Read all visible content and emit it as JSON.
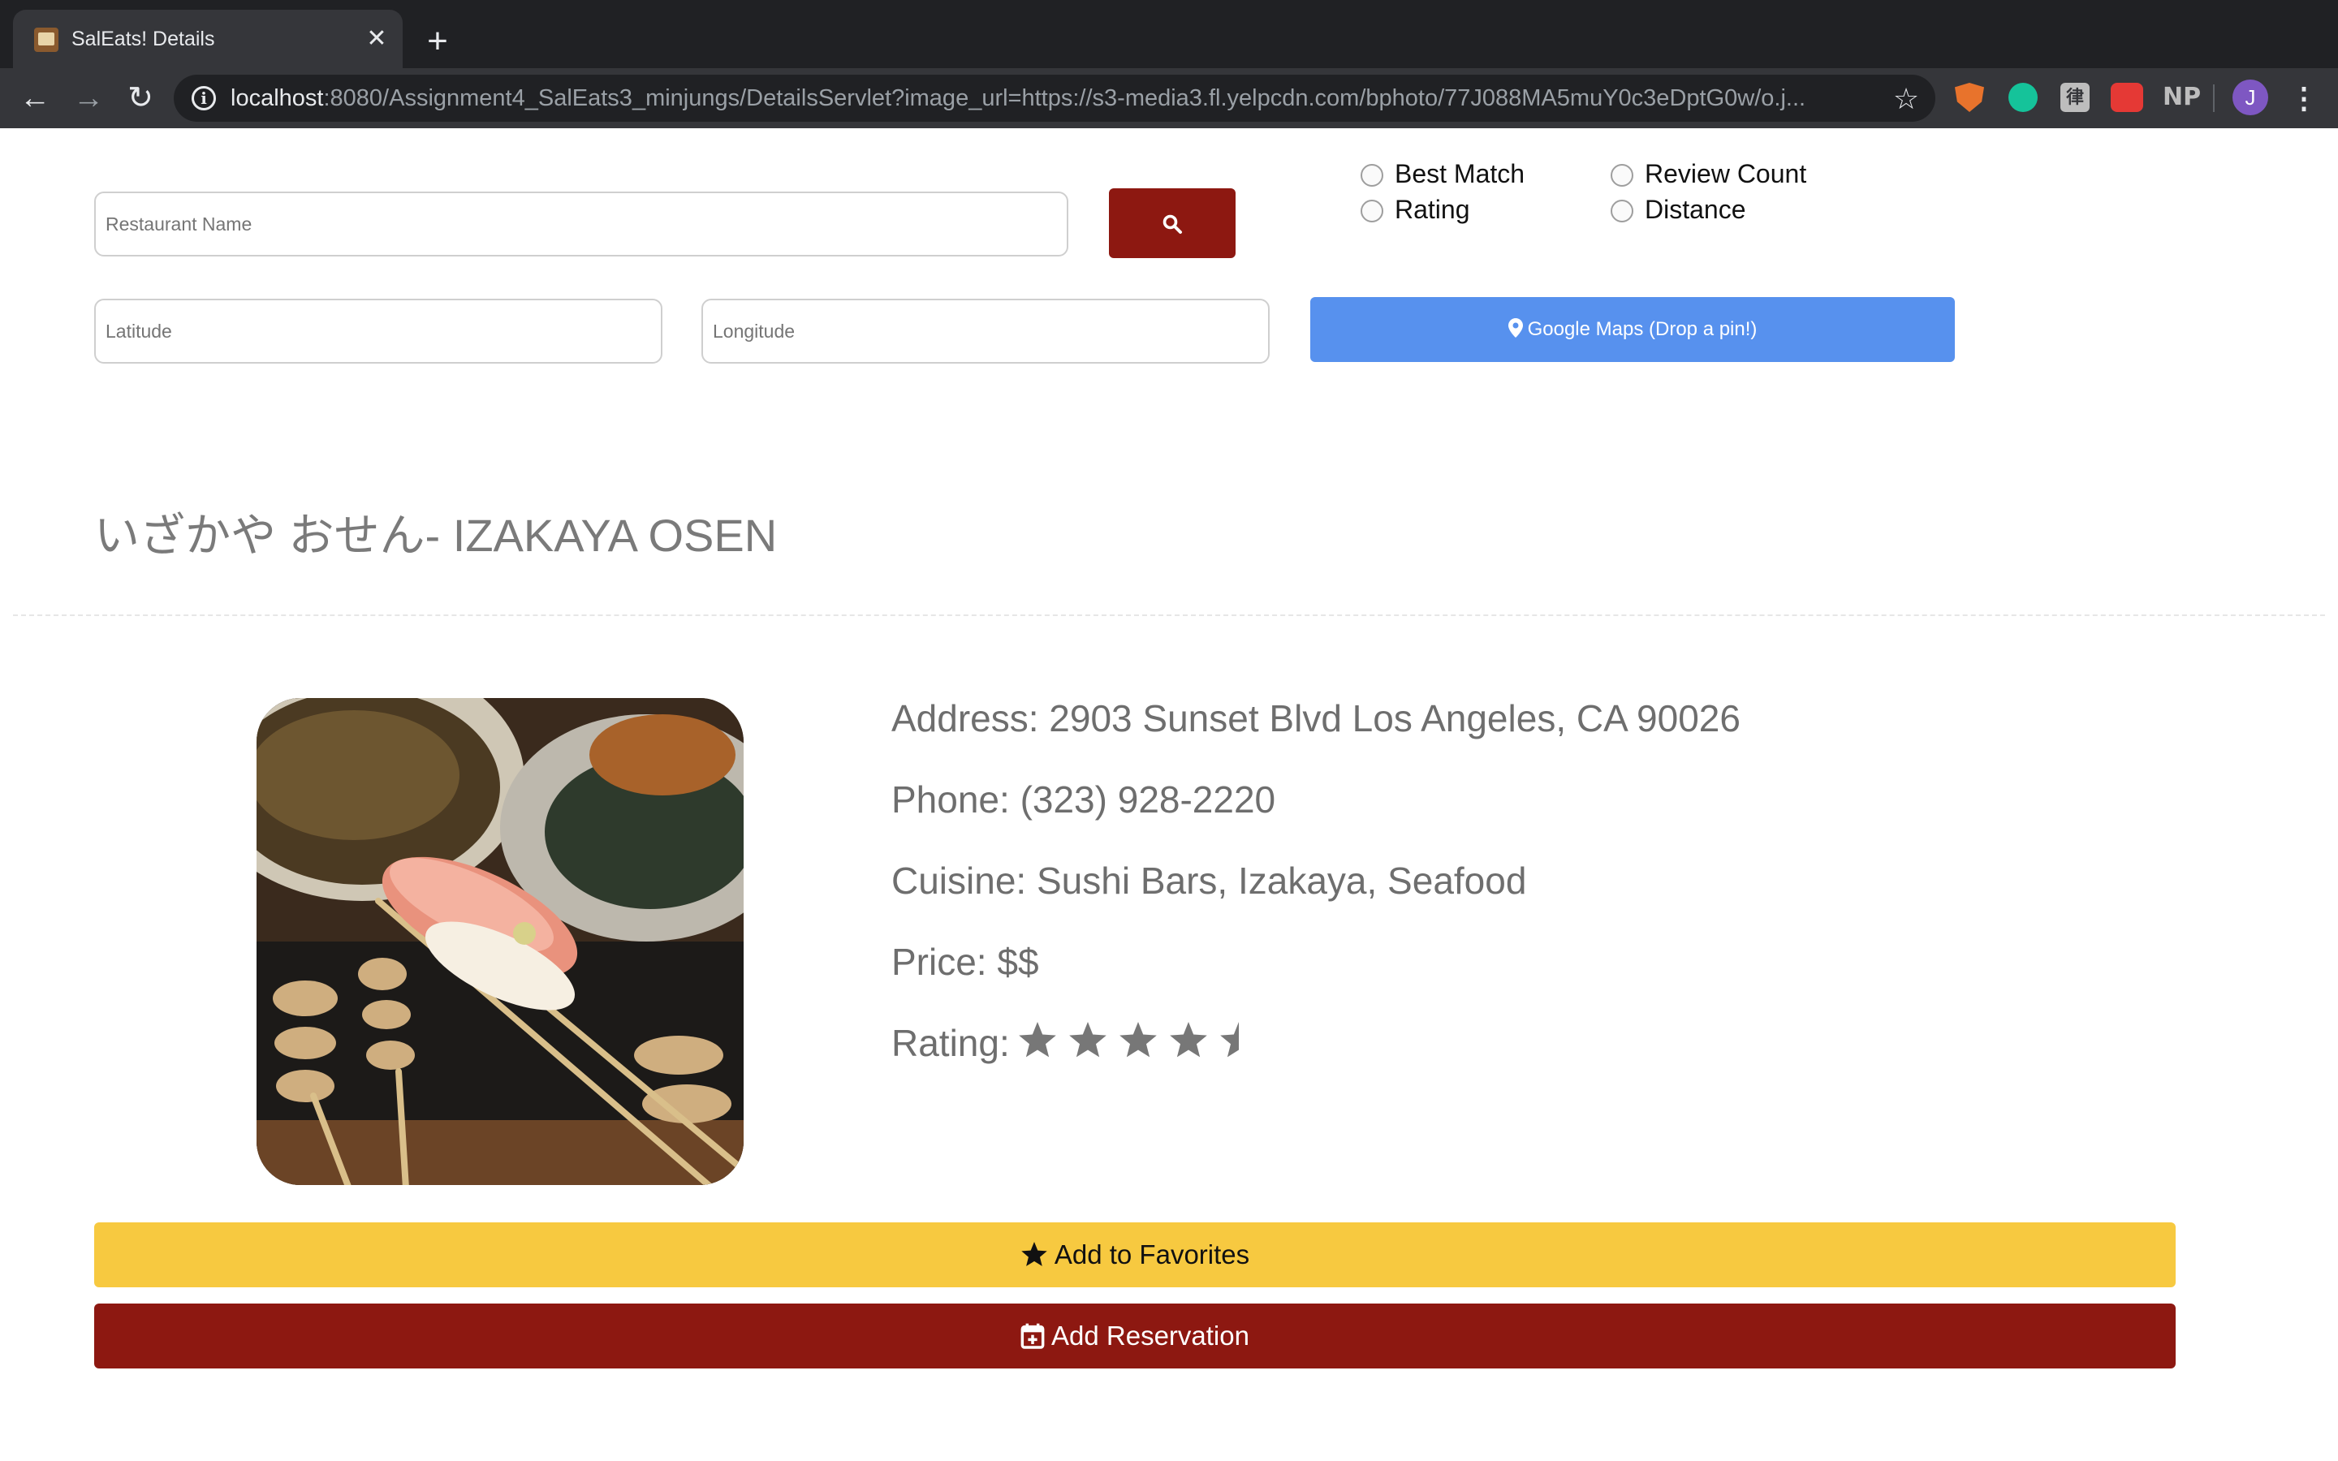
{
  "browser": {
    "tab_title": "SalEats! Details",
    "url_host": "localhost",
    "url_rest": ":8080/Assignment4_SalEats3_minjungs/DetailsServlet?image_url=https://s3-media3.fl.yelpcdn.com/bphoto/77J088MA5muY0c3eDptG0w/o.j...",
    "ext_np_label": "NP",
    "ext_kanji_label": "律",
    "profile_initial": "J"
  },
  "search": {
    "name_placeholder": "Restaurant Name",
    "latitude_placeholder": "Latitude",
    "longitude_placeholder": "Longitude",
    "maps_button_label": "Google Maps (Drop a pin!)",
    "sort_options": [
      "Best Match",
      "Review Count",
      "Rating",
      "Distance"
    ]
  },
  "restaurant": {
    "name": "いざかや おせん- IZAKAYA OSEN",
    "address": "Address: 2903 Sunset Blvd Los Angeles, CA 90026",
    "phone": "Phone: (323) 928-2220",
    "cuisine": "Cuisine: Sushi Bars, Izakaya, Seafood",
    "price": "Price: $$",
    "rating_label": "Rating:",
    "rating": 4.5
  },
  "actions": {
    "favorites_label": "Add to Favorites",
    "reservation_label": "Add Reservation"
  },
  "colors": {
    "brand_red": "#8d1811",
    "maps_blue": "#5791ee",
    "favorites_yellow": "#f7c940"
  }
}
